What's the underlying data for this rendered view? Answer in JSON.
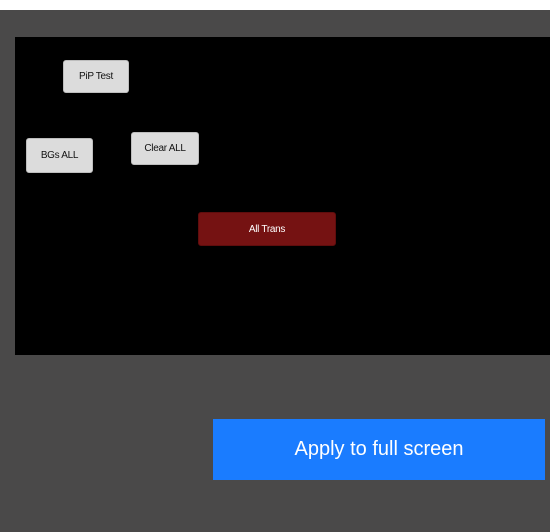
{
  "canvas": {
    "buttons": [
      {
        "label": "PiP Test"
      },
      {
        "label": "Clear ALL"
      },
      {
        "label": "BGs ALL"
      },
      {
        "label": "All Trans"
      }
    ]
  },
  "actions": {
    "apply_label": "Apply to full screen"
  },
  "colors": {
    "panel_bg": "#4a4949",
    "canvas_bg": "#000000",
    "light_button": "#dcdcdc",
    "trans_button": "#751212",
    "apply_button": "#1a7cff"
  }
}
